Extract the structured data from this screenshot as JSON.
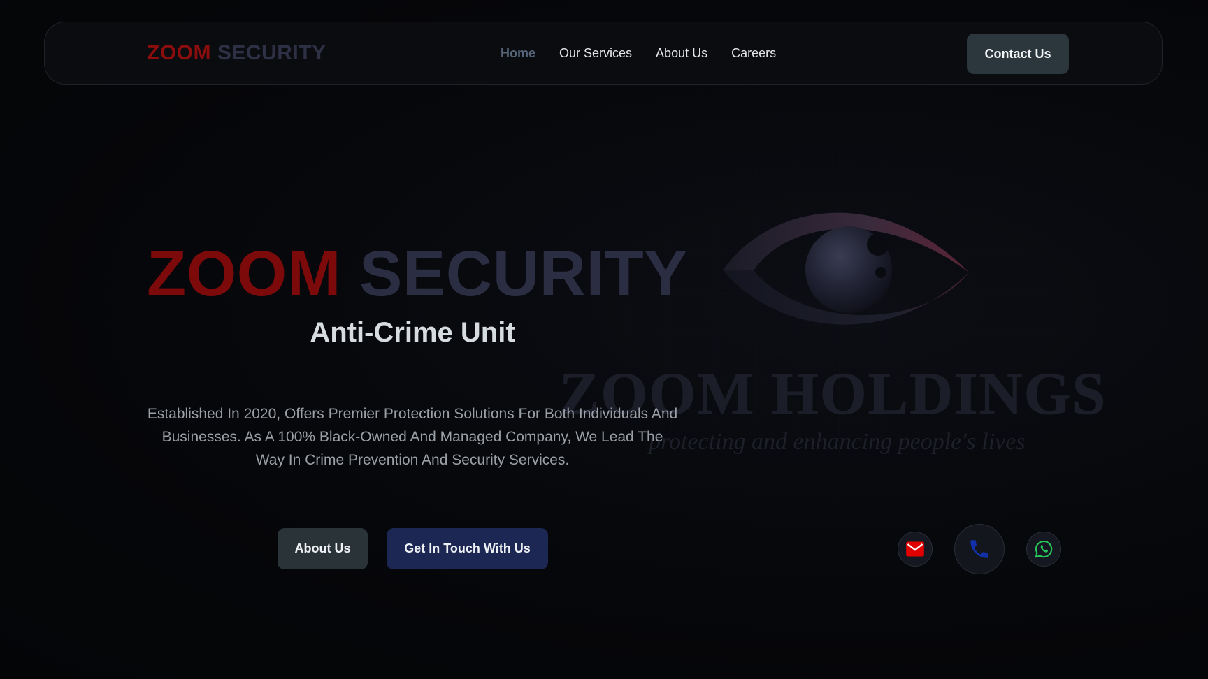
{
  "navbar": {
    "logo": {
      "part1": "ZOOM",
      "part2": "SECURITY"
    },
    "links": [
      {
        "label": "Home",
        "active": true
      },
      {
        "label": "Our Services",
        "active": false
      },
      {
        "label": "About Us",
        "active": false
      },
      {
        "label": "Careers",
        "active": false
      }
    ],
    "cta_label": "Contact Us"
  },
  "hero": {
    "title_part1": "ZOOM",
    "title_part2": "SECURITY",
    "subtitle": "Anti-Crime Unit",
    "description": "Established In 2020, Offers Premier Protection Solutions For Both Individuals And Businesses. As A 100% Black-Owned And Managed Company, We Lead The Way In Crime Prevention And Security Services.",
    "buttons": {
      "about_label": "About Us",
      "touch_label": "Get In Touch With Us"
    }
  },
  "brand_art": {
    "wordmark": "ZOOM HOLDINGS",
    "tagline": "protecting and enhancing people's lives"
  },
  "contact_icons": [
    {
      "icon": "mail-icon",
      "color": "#e00000"
    },
    {
      "icon": "phone-icon",
      "color": "#1230a8"
    },
    {
      "icon": "whatsapp-icon",
      "color": "#25c95a"
    }
  ],
  "colors": {
    "brand_red": "#8b0d0d",
    "brand_slate": "#2e3146",
    "cta_bg": "#2b363d",
    "primary_button": "#1d2754",
    "background": "#050608"
  }
}
